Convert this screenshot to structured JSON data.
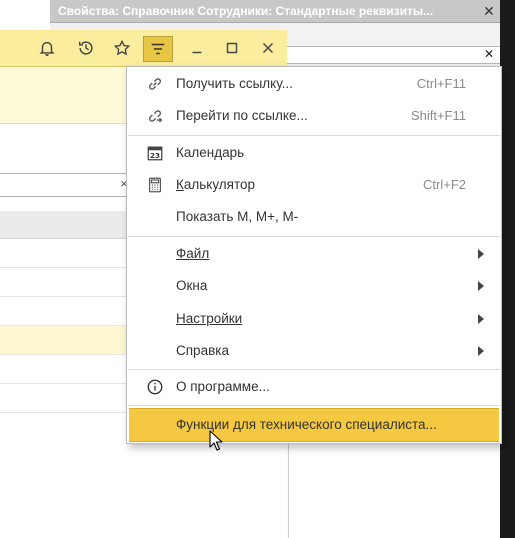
{
  "props_window": {
    "title": "Свойства: Справочник Сотрудники: Стандартные реквизиты...",
    "close_glyph": "✕",
    "field_close_glyph": "✕"
  },
  "main_window": {
    "toolbar": {
      "icons": [
        "bell-icon",
        "history-icon",
        "star-icon",
        "menu-icon",
        "minimize-icon",
        "maximize-icon",
        "close-icon"
      ]
    },
    "search_clear_glyph": "×"
  },
  "menu": {
    "items": [
      {
        "label": "Получить ссылку...",
        "shortcut": "Ctrl+F11",
        "icon": "link-icon"
      },
      {
        "label": "Перейти по ссылке...",
        "shortcut": "Shift+F11",
        "icon": "follow-link-icon"
      },
      {
        "label": "Календарь",
        "shortcut": "",
        "icon": "calendar-icon",
        "icon_text": "23"
      },
      {
        "label": "Калькулятор",
        "shortcut": "Ctrl+F2",
        "icon": "calculator-icon"
      },
      {
        "label": "Показать M, M+, M-",
        "shortcut": "",
        "icon": ""
      },
      {
        "label": "Файл",
        "shortcut": "",
        "submenu": true
      },
      {
        "label": "Окна",
        "shortcut": "",
        "submenu": true
      },
      {
        "label": "Настройки",
        "shortcut": "",
        "submenu": true
      },
      {
        "label": "Справка",
        "shortcut": "",
        "submenu": true
      },
      {
        "label": "О программе...",
        "shortcut": "",
        "icon": "info-icon"
      },
      {
        "label": "Функции для технического специалиста...",
        "shortcut": "",
        "highlighted": true
      }
    ]
  },
  "colors": {
    "toolbar_bg": "#fbed9e",
    "menu_highlight": "#f5c842",
    "active_menu_button": "#e6c644"
  }
}
